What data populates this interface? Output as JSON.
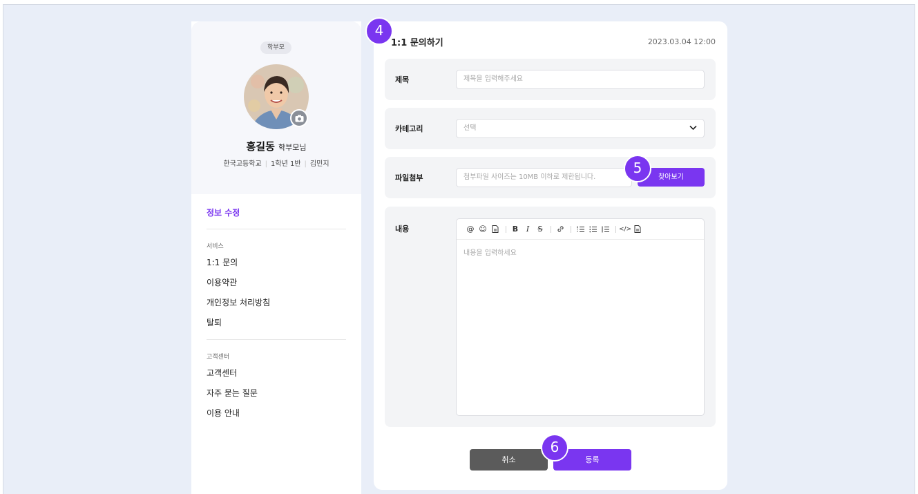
{
  "sidebar": {
    "role_badge": "학부모",
    "name": "홍길동",
    "name_suffix": "학부모님",
    "school": "한국고등학교",
    "class": "1학년 1반",
    "student": "김민지",
    "edit_info": "정보 수정",
    "service_section": {
      "label": "서비스",
      "items": [
        "1:1 문의",
        "이용약관",
        "개인정보 처리방침",
        "탈퇴"
      ]
    },
    "support_section": {
      "label": "고객센터",
      "items": [
        "고객센터",
        "자주 묻는 질문",
        "이용 안내"
      ]
    }
  },
  "form": {
    "title": "1:1 문의하기",
    "datetime": "2023.03.04 12:00",
    "subject": {
      "label": "제목",
      "placeholder": "제목을 입력해주세요"
    },
    "category": {
      "label": "카테고리",
      "value": "선택"
    },
    "attachment": {
      "label": "파일첨부",
      "placeholder": "첨부파일 사이즈는 10MB 이하로 제한됩니다.",
      "button": "찾아보기"
    },
    "content": {
      "label": "내용",
      "placeholder": "내용을 입력하세요",
      "toolbar": [
        "at-icon",
        "emoji-icon",
        "file-icon",
        "bold-icon",
        "italic-icon",
        "strikethrough-icon",
        "link-icon",
        "ordered-list-icon",
        "bullet-list-icon",
        "checklist-icon",
        "code-icon",
        "document-icon"
      ]
    },
    "cancel_button": "취소",
    "submit_button": "등록"
  },
  "step_markers": [
    "4",
    "5",
    "6"
  ],
  "colors": {
    "accent": "#7a36f0",
    "background": "#e9eef8",
    "cancel": "#5b5b5b"
  }
}
